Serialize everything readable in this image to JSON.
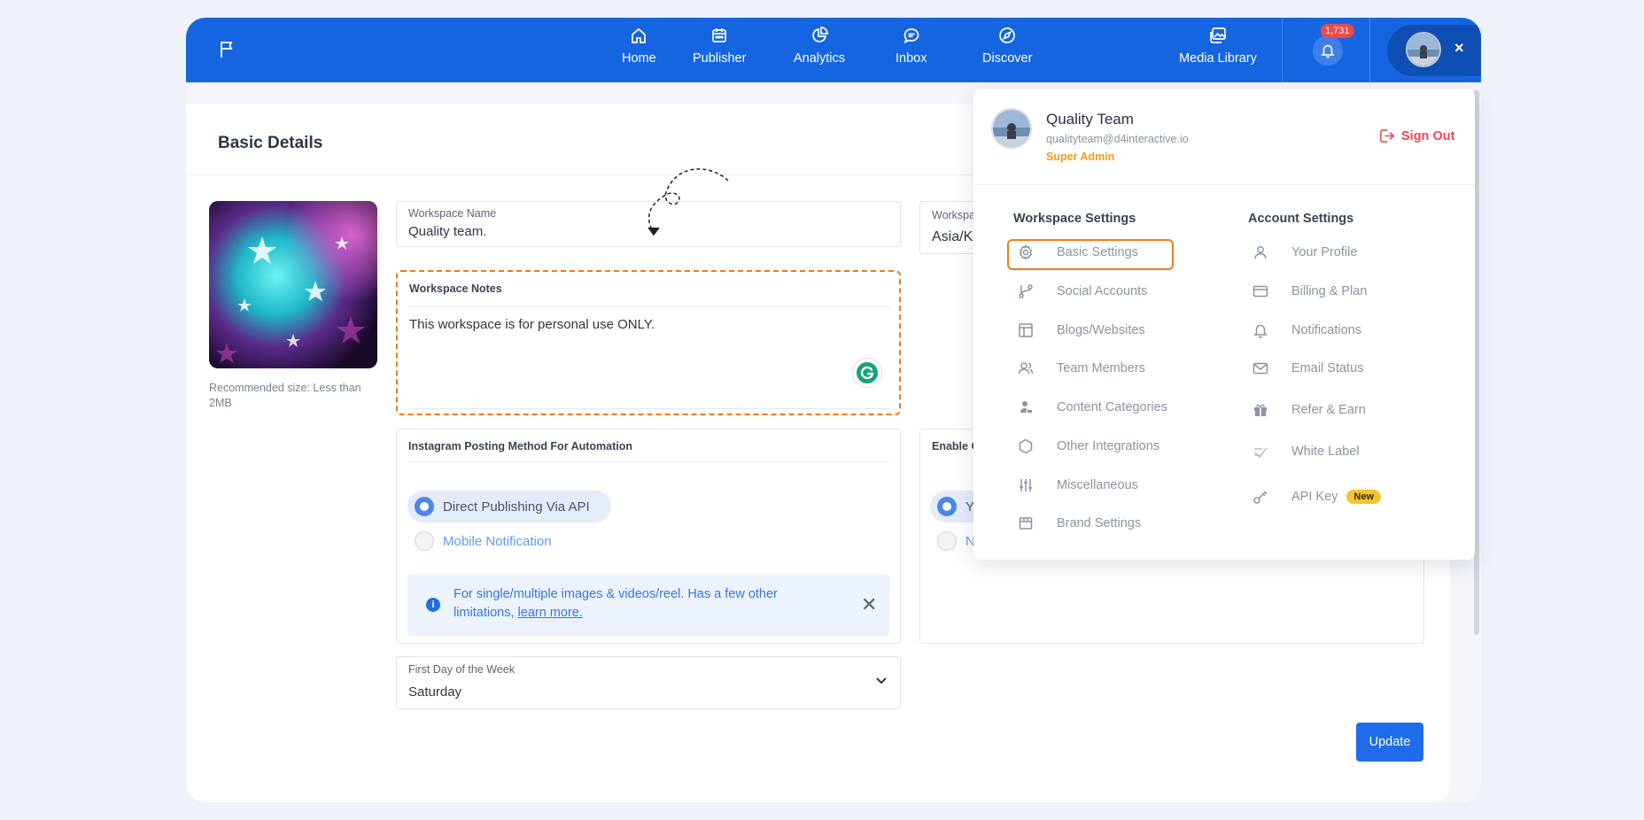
{
  "nav": {
    "items": [
      {
        "label": "Home",
        "icon": "home-icon"
      },
      {
        "label": "Publisher",
        "icon": "calendar-icon"
      },
      {
        "label": "Analytics",
        "icon": "pie-chart-icon"
      },
      {
        "label": "Inbox",
        "icon": "chat-icon"
      },
      {
        "label": "Discover",
        "icon": "compass-icon"
      },
      {
        "label": "Media Library",
        "icon": "images-icon"
      }
    ],
    "notification_count": "1,731",
    "close": "×"
  },
  "page": {
    "title": "Basic Details",
    "recommended": "Recommended size: Less than 2MB",
    "workspace_name_label": "Workspace Name",
    "workspace_name_value": "Quality team.",
    "workspace_tz_label": "Workspa",
    "workspace_tz_value": "Asia/K",
    "notes_label": "Workspace Notes",
    "notes_value": "This workspace is for personal use ONLY.",
    "instagram_label": "Instagram Posting Method For Automation",
    "option_direct": "Direct Publishing Via API",
    "option_mobile": "Mobile Notification",
    "info_text": "For single/multiple images & videos/reel. Has a few other limitations, ",
    "info_link": "learn more.",
    "enable_label": "Enable C",
    "enable_yes": "Y",
    "enable_no": "N",
    "first_day_label": "First Day of the Week",
    "first_day_value": "Saturday",
    "update_button": "Update"
  },
  "profile_menu": {
    "name": "Quality Team",
    "email": "qualityteam@d4interactive.io",
    "role": "Super Admin",
    "sign_out": "Sign Out",
    "workspace_title": "Workspace Settings",
    "account_title": "Account Settings",
    "workspace_items": [
      {
        "label": "Basic Settings",
        "icon": "gear-icon"
      },
      {
        "label": "Social Accounts",
        "icon": "branch-icon"
      },
      {
        "label": "Blogs/Websites",
        "icon": "layout-icon"
      },
      {
        "label": "Team Members",
        "icon": "users-icon"
      },
      {
        "label": "Content Categories",
        "icon": "user-tag-icon"
      },
      {
        "label": "Other Integrations",
        "icon": "hexagon-icon"
      },
      {
        "label": "Miscellaneous",
        "icon": "sliders-icon"
      },
      {
        "label": "Brand Settings",
        "icon": "store-icon"
      }
    ],
    "account_items": [
      {
        "label": "Your Profile",
        "icon": "user-icon"
      },
      {
        "label": "Billing & Plan",
        "icon": "card-icon"
      },
      {
        "label": "Notifications",
        "icon": "bell-icon"
      },
      {
        "label": "Email Status",
        "icon": "mail-icon"
      },
      {
        "label": "Refer & Earn",
        "icon": "gift-icon"
      },
      {
        "label": "White Label",
        "icon": "label-icon"
      },
      {
        "label": "API Key",
        "icon": "key-icon",
        "badge": "New"
      }
    ]
  },
  "colors": {
    "topbar": "#1565e0",
    "accent": "#1f6bea",
    "highlight": "#f07a1a",
    "signout": "#f0455e",
    "role": "#f09a1c"
  }
}
